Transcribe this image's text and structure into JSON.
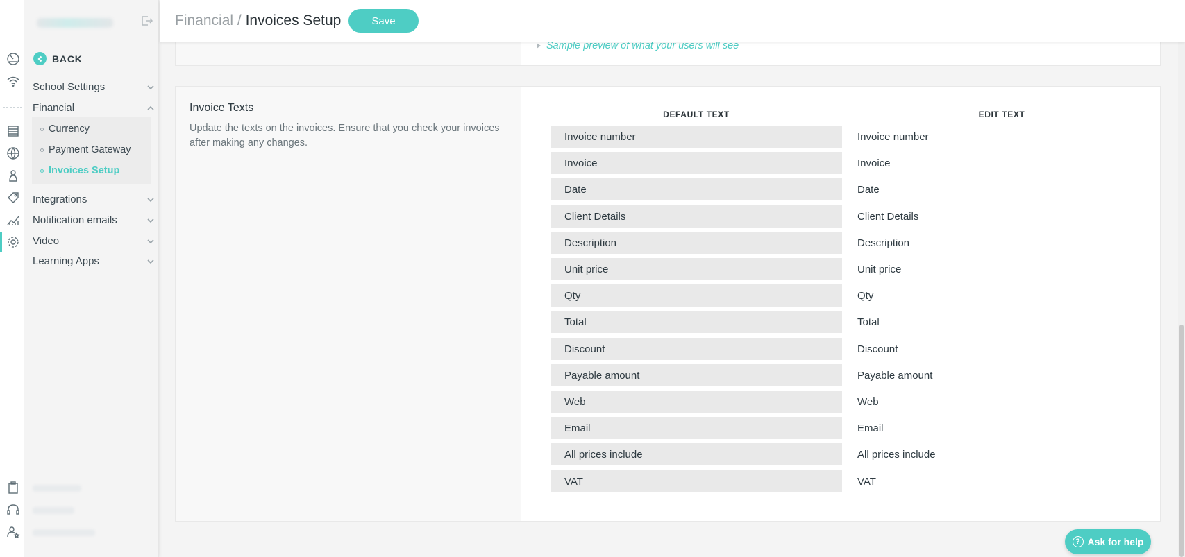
{
  "rail": {
    "icons": [
      "dashboard-icon",
      "wifi-icon",
      "list-icon",
      "globe-icon",
      "user-icon",
      "tag-icon",
      "chart-icon",
      "gear-icon",
      "clipboard-icon",
      "headset-icon",
      "team-icon"
    ]
  },
  "sidebar": {
    "back_label": "BACK",
    "items": [
      {
        "label": "School Settings",
        "expanded": false
      },
      {
        "label": "Financial",
        "expanded": true
      },
      {
        "label": "Integrations",
        "expanded": false
      },
      {
        "label": "Notification emails",
        "expanded": false
      },
      {
        "label": "Video",
        "expanded": false
      },
      {
        "label": "Learning Apps",
        "expanded": false
      }
    ],
    "financial_sub": [
      {
        "label": "Currency",
        "active": false
      },
      {
        "label": "Payment Gateway",
        "active": false
      },
      {
        "label": "Invoices Setup",
        "active": true
      }
    ]
  },
  "header": {
    "breadcrumb_parent": "Financial",
    "breadcrumb_sep": " / ",
    "breadcrumb_current": "Invoices Setup",
    "save_label": "Save"
  },
  "preview": {
    "link_label": "Sample preview of what your users will see"
  },
  "invoice_texts": {
    "title": "Invoice Texts",
    "description": "Update the texts on the invoices. Ensure that you check your invoices after making any changes.",
    "col_default": "DEFAULT TEXT",
    "col_edit": "EDIT TEXT",
    "rows": [
      {
        "default": "Invoice number",
        "edit": "Invoice number"
      },
      {
        "default": "Invoice",
        "edit": "Invoice"
      },
      {
        "default": "Date",
        "edit": "Date"
      },
      {
        "default": "Client Details",
        "edit": "Client Details"
      },
      {
        "default": "Description",
        "edit": "Description"
      },
      {
        "default": "Unit price",
        "edit": "Unit price"
      },
      {
        "default": "Qty",
        "edit": "Qty"
      },
      {
        "default": "Total",
        "edit": "Total"
      },
      {
        "default": "Discount",
        "edit": "Discount"
      },
      {
        "default": "Payable amount",
        "edit": "Payable amount"
      },
      {
        "default": "Web",
        "edit": "Web"
      },
      {
        "default": "Email",
        "edit": "Email"
      },
      {
        "default": "All prices include",
        "edit": "All prices include"
      },
      {
        "default": "VAT",
        "edit": "VAT"
      }
    ]
  },
  "help": {
    "label": "Ask for help"
  },
  "colors": {
    "accent": "#4ecdc4"
  }
}
